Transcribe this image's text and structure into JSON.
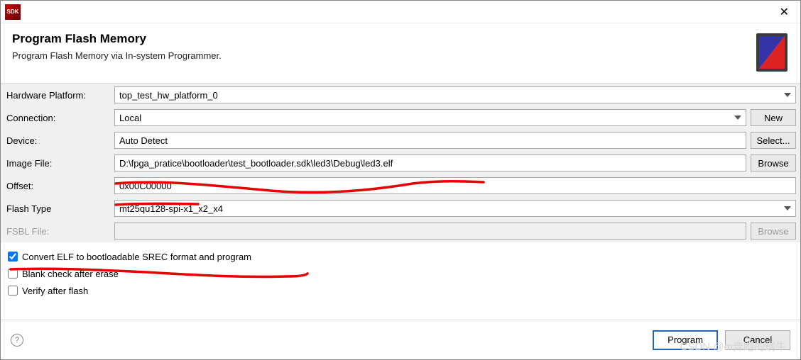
{
  "titlebar": {
    "close_tooltip": "Close"
  },
  "header": {
    "title": "Program Flash Memory",
    "subtitle": "Program Flash Memory via In-system Programmer."
  },
  "labels": {
    "hardware_platform": "Hardware Platform:",
    "connection": "Connection:",
    "device": "Device:",
    "image_file": "Image File:",
    "offset": "Offset:",
    "flash_type": "Flash Type",
    "fsbl_file": "FSBL File:"
  },
  "values": {
    "hardware_platform": "top_test_hw_platform_0",
    "connection": "Local",
    "device": "Auto Detect",
    "image_file": "D:\\fpga_pratice\\bootloader\\test_bootloader.sdk\\led3\\Debug\\led3.elf",
    "offset": "0x00C00000",
    "flash_type": "mt25qu128-spi-x1_x2_x4",
    "fsbl_file": ""
  },
  "buttons": {
    "new": "New",
    "select": "Select...",
    "browse": "Browse",
    "program": "Program",
    "cancel": "Cancel"
  },
  "checkboxes": {
    "convert_elf": {
      "label": "Convert ELF to bootloadable SREC format and program",
      "checked": true
    },
    "blank_check": {
      "label": "Blank check after erase",
      "checked": false
    },
    "verify": {
      "label": "Verify after flash",
      "checked": false
    }
  },
  "watermark": "CSDN @m奔跑的蜗牛"
}
